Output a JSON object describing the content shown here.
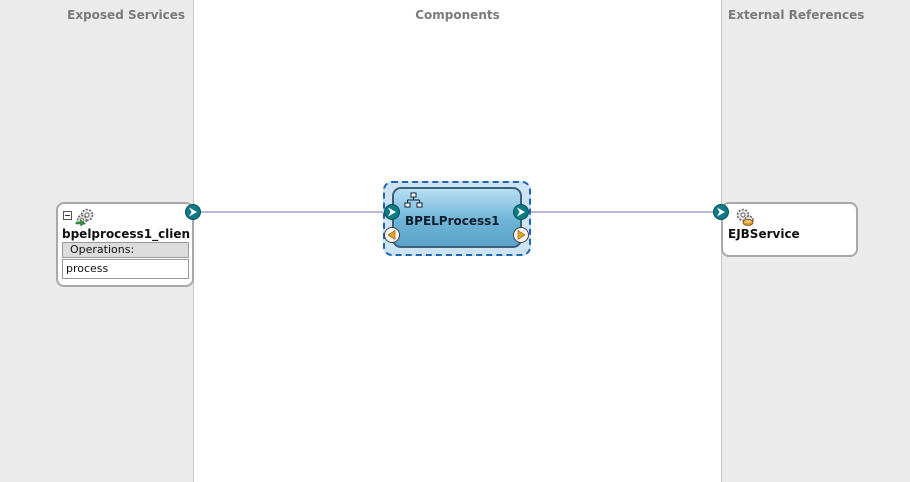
{
  "columns": {
    "exposed_services": "Exposed Services",
    "components": "Components",
    "external_references": "External References"
  },
  "service": {
    "name": "bpelprocess1_client...",
    "operations_label": "Operations:",
    "operations": [
      "process"
    ]
  },
  "component": {
    "name": "BPELProcess1"
  },
  "reference": {
    "name": "EJBService"
  },
  "colors": {
    "wire": "#b8b8d8",
    "port_fill": "#0e7a86",
    "callback_port": "#e8a020",
    "component_fill": "#6eb4d8",
    "selection_border": "#1e64b4"
  }
}
